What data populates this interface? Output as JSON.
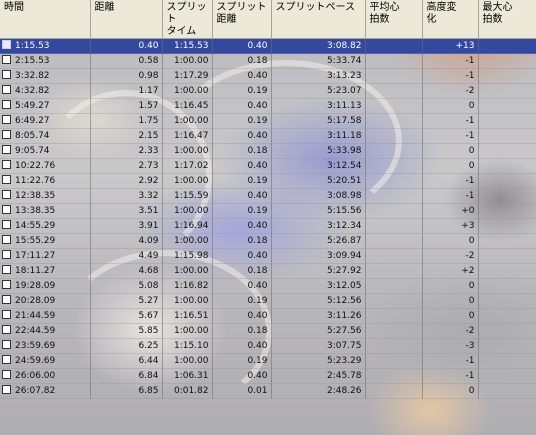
{
  "columns": [
    "時間",
    "距離",
    "スプリット\nタイム",
    "スプリット\n距離",
    "スプリットペース",
    "平均心\n拍数",
    "高度変\n化",
    "最大心\n拍数"
  ],
  "rows": [
    {
      "time": "1:15.53",
      "dist": "0.40",
      "split_time": "1:15.53",
      "split_dist": "0.40",
      "pace": "3:08.82",
      "avg_hr": "",
      "alt": "+13",
      "max_hr": "",
      "selected": true
    },
    {
      "time": "2:15.53",
      "dist": "0.58",
      "split_time": "1:00.00",
      "split_dist": "0.18",
      "pace": "5:33.74",
      "avg_hr": "",
      "alt": "-1",
      "max_hr": ""
    },
    {
      "time": "3:32.82",
      "dist": "0.98",
      "split_time": "1:17.29",
      "split_dist": "0.40",
      "pace": "3:13.23",
      "avg_hr": "",
      "alt": "-1",
      "max_hr": ""
    },
    {
      "time": "4:32.82",
      "dist": "1.17",
      "split_time": "1:00.00",
      "split_dist": "0.19",
      "pace": "5:23.07",
      "avg_hr": "",
      "alt": "-2",
      "max_hr": ""
    },
    {
      "time": "5:49.27",
      "dist": "1.57",
      "split_time": "1:16.45",
      "split_dist": "0.40",
      "pace": "3:11.13",
      "avg_hr": "",
      "alt": "0",
      "max_hr": ""
    },
    {
      "time": "6:49.27",
      "dist": "1.75",
      "split_time": "1:00.00",
      "split_dist": "0.19",
      "pace": "5:17.58",
      "avg_hr": "",
      "alt": "-1",
      "max_hr": ""
    },
    {
      "time": "8:05.74",
      "dist": "2.15",
      "split_time": "1:16.47",
      "split_dist": "0.40",
      "pace": "3:11.18",
      "avg_hr": "",
      "alt": "-1",
      "max_hr": ""
    },
    {
      "time": "9:05.74",
      "dist": "2.33",
      "split_time": "1:00.00",
      "split_dist": "0.18",
      "pace": "5:33.98",
      "avg_hr": "",
      "alt": "0",
      "max_hr": ""
    },
    {
      "time": "10:22.76",
      "dist": "2.73",
      "split_time": "1:17.02",
      "split_dist": "0.40",
      "pace": "3:12.54",
      "avg_hr": "",
      "alt": "0",
      "max_hr": ""
    },
    {
      "time": "11:22.76",
      "dist": "2.92",
      "split_time": "1:00.00",
      "split_dist": "0.19",
      "pace": "5:20.51",
      "avg_hr": "",
      "alt": "-1",
      "max_hr": ""
    },
    {
      "time": "12:38.35",
      "dist": "3.32",
      "split_time": "1:15.59",
      "split_dist": "0.40",
      "pace": "3:08.98",
      "avg_hr": "",
      "alt": "-1",
      "max_hr": ""
    },
    {
      "time": "13:38.35",
      "dist": "3.51",
      "split_time": "1:00.00",
      "split_dist": "0.19",
      "pace": "5:15.56",
      "avg_hr": "",
      "alt": "+0",
      "max_hr": ""
    },
    {
      "time": "14:55.29",
      "dist": "3.91",
      "split_time": "1:16.94",
      "split_dist": "0.40",
      "pace": "3:12.34",
      "avg_hr": "",
      "alt": "+3",
      "max_hr": ""
    },
    {
      "time": "15:55.29",
      "dist": "4.09",
      "split_time": "1:00.00",
      "split_dist": "0.18",
      "pace": "5:26.87",
      "avg_hr": "",
      "alt": "0",
      "max_hr": ""
    },
    {
      "time": "17:11.27",
      "dist": "4.49",
      "split_time": "1:15.98",
      "split_dist": "0.40",
      "pace": "3:09.94",
      "avg_hr": "",
      "alt": "-2",
      "max_hr": ""
    },
    {
      "time": "18:11.27",
      "dist": "4.68",
      "split_time": "1:00.00",
      "split_dist": "0.18",
      "pace": "5:27.92",
      "avg_hr": "",
      "alt": "+2",
      "max_hr": ""
    },
    {
      "time": "19:28.09",
      "dist": "5.08",
      "split_time": "1:16.82",
      "split_dist": "0.40",
      "pace": "3:12.05",
      "avg_hr": "",
      "alt": "0",
      "max_hr": ""
    },
    {
      "time": "20:28.09",
      "dist": "5.27",
      "split_time": "1:00.00",
      "split_dist": "0.19",
      "pace": "5:12.56",
      "avg_hr": "",
      "alt": "0",
      "max_hr": ""
    },
    {
      "time": "21:44.59",
      "dist": "5.67",
      "split_time": "1:16.51",
      "split_dist": "0.40",
      "pace": "3:11.26",
      "avg_hr": "",
      "alt": "0",
      "max_hr": ""
    },
    {
      "time": "22:44.59",
      "dist": "5.85",
      "split_time": "1:00.00",
      "split_dist": "0.18",
      "pace": "5:27.56",
      "avg_hr": "",
      "alt": "-2",
      "max_hr": ""
    },
    {
      "time": "23:59.69",
      "dist": "6.25",
      "split_time": "1:15.10",
      "split_dist": "0.40",
      "pace": "3:07.75",
      "avg_hr": "",
      "alt": "-3",
      "max_hr": ""
    },
    {
      "time": "24:59.69",
      "dist": "6.44",
      "split_time": "1:00.00",
      "split_dist": "0.19",
      "pace": "5:23.29",
      "avg_hr": "",
      "alt": "-1",
      "max_hr": ""
    },
    {
      "time": "26:06.00",
      "dist": "6.84",
      "split_time": "1:06.31",
      "split_dist": "0.40",
      "pace": "2:45.78",
      "avg_hr": "",
      "alt": "-1",
      "max_hr": ""
    },
    {
      "time": "26:07.82",
      "dist": "6.85",
      "split_time": "0:01.82",
      "split_dist": "0.01",
      "pace": "2:48.26",
      "avg_hr": "",
      "alt": "0",
      "max_hr": ""
    }
  ],
  "colors": {
    "selection": "#33489f",
    "header_bg": "#ece9d8"
  }
}
